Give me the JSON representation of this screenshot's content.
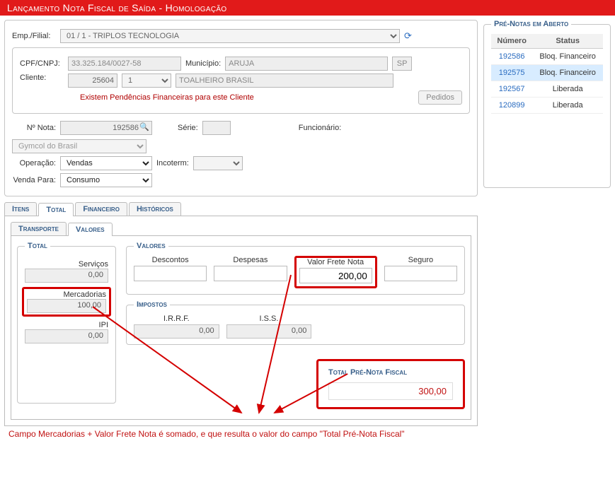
{
  "header": {
    "title": "Lançamento Nota Fiscal de Saída  - Homologação"
  },
  "emp": {
    "label": "Emp./Filial:",
    "value": "01 / 1 - TRIPLOS TECNOLOGIA"
  },
  "cliente_box": {
    "cpf_label": "CPF/CNPJ:",
    "cpf": "33.325.184/0027-58",
    "mun_label": "Município:",
    "mun": "ARUJA",
    "uf": "SP",
    "cli_label": "Cliente:",
    "cli_code": "25604",
    "cli_seq": "1",
    "cli_name": "TOALHEIRO BRASIL",
    "warn": "Existem Pendências Financeiras para este Cliente",
    "pedidos_btn": "Pedidos"
  },
  "nota": {
    "num_label": "Nº Nota:",
    "num": "192586",
    "serie_label": "Série:",
    "serie": "",
    "func_label": "Funcionário:",
    "func": "Gymcol do Brasil",
    "oper_label": "Operação:",
    "oper": "Vendas",
    "incoterm_label": "Incoterm:",
    "incoterm": "",
    "venda_label": "Venda Para:",
    "venda": "Consumo"
  },
  "tabs_main": {
    "itens": "Itens",
    "total": "Total",
    "financeiro": "Financeiro",
    "historicos": "Históricos"
  },
  "tabs_sub": {
    "transporte": "Transporte",
    "valores": "Valores"
  },
  "total_panel": {
    "legend": "Total",
    "servicos_label": "Serviços",
    "servicos": "0,00",
    "mercadorias_label": "Mercadorias",
    "mercadorias": "100,00",
    "ipi_label": "IPI",
    "ipi": "0,00"
  },
  "valores_panel": {
    "legend": "Valores",
    "descontos_h": "Descontos",
    "descontos": "",
    "despesas_h": "Despesas",
    "despesas": "",
    "frete_h": "Valor Frete Nota",
    "frete": "200,00",
    "seguro_h": "Seguro",
    "seguro": ""
  },
  "impostos_panel": {
    "legend": "Impostos",
    "irrf_h": "I.R.R.F.",
    "irrf": "0,00",
    "iss_h": "I.S.S.",
    "iss": "0,00"
  },
  "total_final": {
    "title": "Total Pré-Nota Fiscal",
    "value": "300,00"
  },
  "note": "Campo Mercadorias + Valor Frete Nota é somado, e que resulta o valor do campo \"Total Pré-Nota Fiscal\"",
  "pre_notas": {
    "legend": "Pré-Notas em Aberto",
    "col_num": "Número",
    "col_status": "Status",
    "rows": [
      {
        "num": "192586",
        "status": "Bloq. Financeiro",
        "hl": false
      },
      {
        "num": "192575",
        "status": "Bloq. Financeiro",
        "hl": true
      },
      {
        "num": "192567",
        "status": "Liberada",
        "hl": false
      },
      {
        "num": "120899",
        "status": "Liberada",
        "hl": false
      }
    ]
  }
}
